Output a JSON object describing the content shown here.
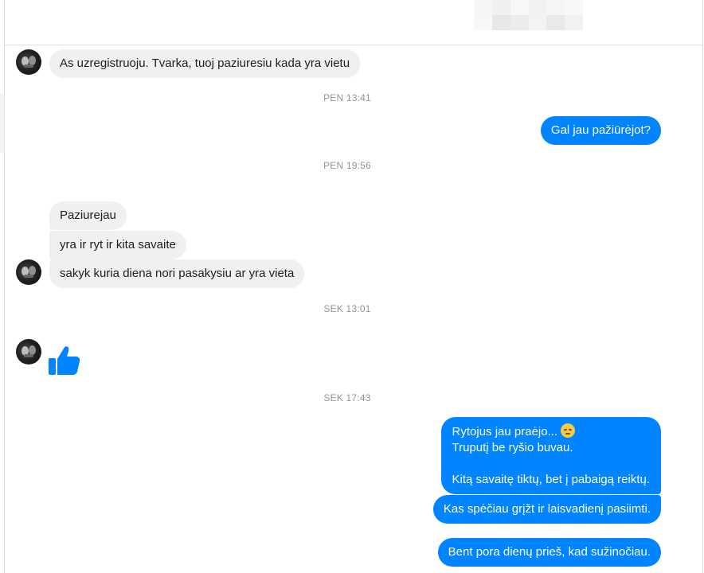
{
  "colors": {
    "outgoing_bubble": "#0084ff",
    "incoming_bubble": "#f1f0f0",
    "timestamp": "#90949c",
    "like": "#0084ff"
  },
  "header": {
    "blurred_name_block": "blurred"
  },
  "messages": [
    {
      "side": "in",
      "text": "As uzregistruoju. Tvarka, tuoj paziuresiu kada yra vietu"
    },
    {
      "type": "timestamp",
      "text": "PEN 13:41"
    },
    {
      "side": "out",
      "text": "Gal jau pažiūrėjot?"
    },
    {
      "type": "timestamp",
      "text": "PEN 19:56"
    },
    {
      "side": "in",
      "text": "Paziurejau"
    },
    {
      "side": "in",
      "text": "yra ir ryt ir kita savaite"
    },
    {
      "side": "in",
      "text": "sakyk kuria diena nori pasakysiu ar yra vieta"
    },
    {
      "type": "timestamp",
      "text": "SEK 13:01"
    },
    {
      "side": "in",
      "type": "like",
      "icon": "thumbs-up-icon"
    },
    {
      "type": "timestamp",
      "text": "SEK 17:43"
    },
    {
      "side": "out",
      "lines": [
        "Rytojus jau praėjo...",
        "Truputį be ryšio buvau.",
        "",
        "Kitą savaitę tiktų, bet į pabaigą reiktų."
      ],
      "emoji": "disappointed-face-icon"
    },
    {
      "side": "out",
      "text": "Kas spėčiau grįžt ir laisvadienį pasiimti."
    },
    {
      "side": "out",
      "text": "Bent pora dienų prieš, kad sužinočiau."
    }
  ]
}
